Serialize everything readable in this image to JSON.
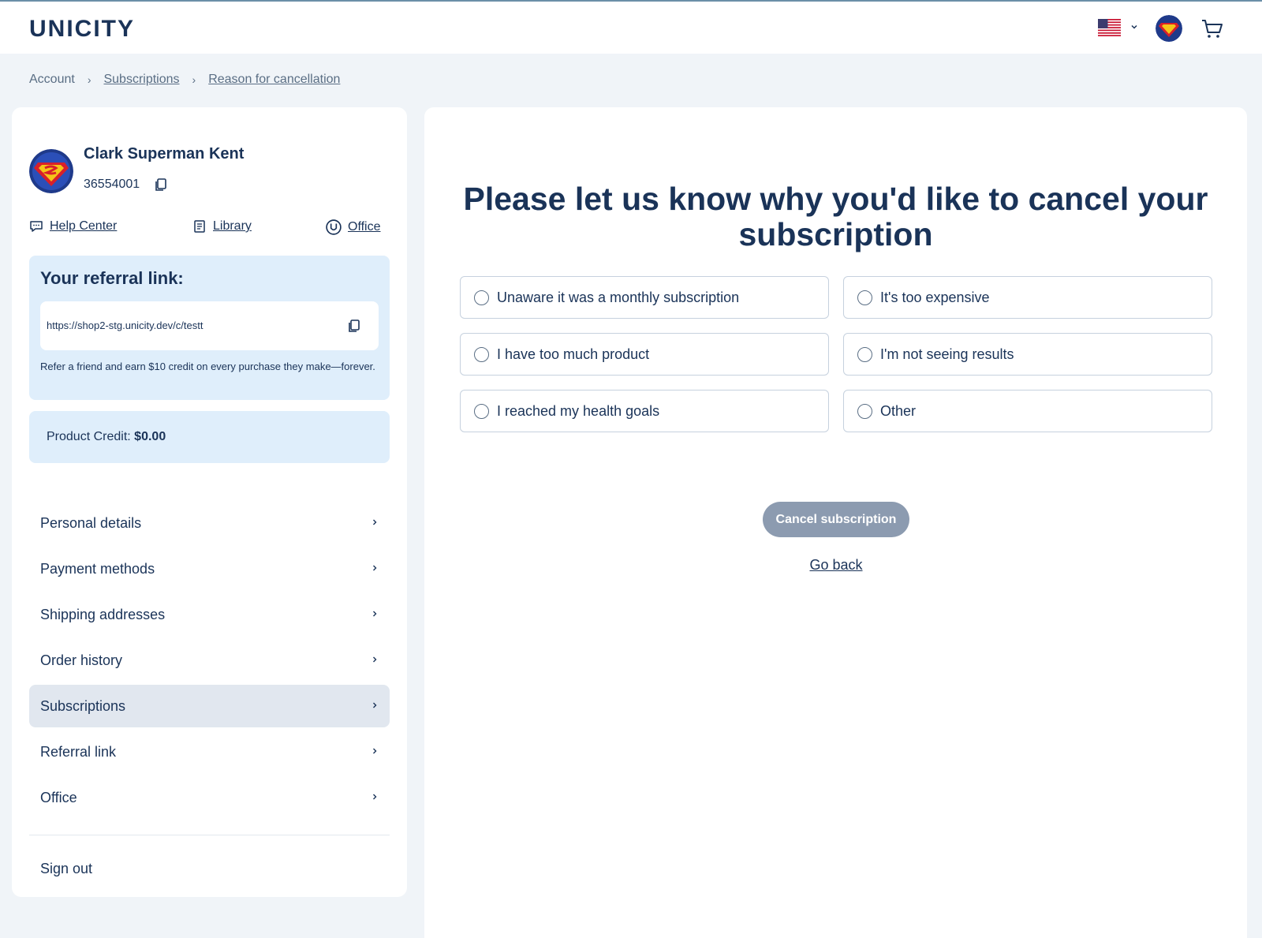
{
  "header": {
    "logo": "UNICITY",
    "country_flag": "us-flag-icon",
    "icons": [
      "chevron-down-icon",
      "avatar",
      "cart-icon"
    ]
  },
  "breadcrumb": {
    "items": [
      "Account",
      "Subscriptions",
      "Reason for cancellation"
    ]
  },
  "profile": {
    "name": "Clark Superman Kent",
    "id": "36554001"
  },
  "quick_links": {
    "help_center": "Help Center",
    "library": "Library",
    "office": "Office"
  },
  "referral": {
    "title": "Your referral link:",
    "url": "https://shop2-stg.unicity.dev/c/testt",
    "description": "Refer a friend and earn $10 credit on every purchase they make—forever."
  },
  "credit": {
    "label": "Product Credit:",
    "value": "$0.00"
  },
  "nav": {
    "items": [
      {
        "label": "Personal details"
      },
      {
        "label": "Payment methods"
      },
      {
        "label": "Shipping addresses"
      },
      {
        "label": "Order history"
      },
      {
        "label": "Subscriptions",
        "active": true
      },
      {
        "label": "Referral link"
      },
      {
        "label": "Office"
      }
    ],
    "sign_out": "Sign out"
  },
  "main": {
    "title": "Please let us know why you'd like to cancel your subscription",
    "options": [
      "Unaware it was a monthly subscription",
      "It's too expensive",
      "I have too much product",
      "I'm not seeing results",
      "I reached my health goals",
      "Other"
    ],
    "cancel_button": "Cancel subscription",
    "go_back": "Go back"
  },
  "colors": {
    "primary": "#1a3358",
    "background": "#f0f4f8",
    "panel_blue": "#dfeefb",
    "disabled_button": "#8c9bb0"
  }
}
